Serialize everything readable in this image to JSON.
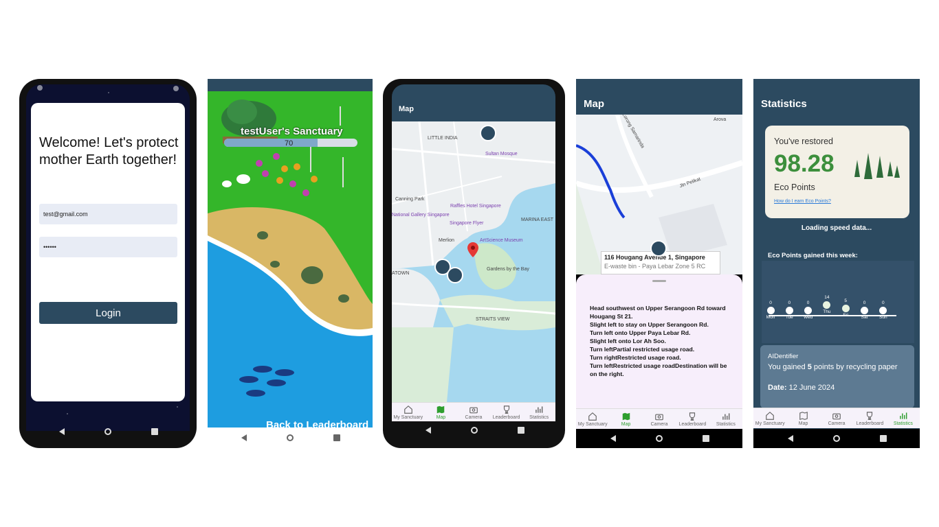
{
  "login": {
    "welcome": "Welcome! Let's protect mother Earth together!",
    "email": "test@gmail.com",
    "password": "••••••",
    "login_button": "Login"
  },
  "sanctuary": {
    "title": "testUser's Sanctuary",
    "xp_value": "70",
    "xp_fraction": 0.7,
    "back_button": "Back to Leaderboard"
  },
  "map": {
    "title": "Map",
    "labels": [
      "LITTLE INDIA",
      "Canning Park",
      "Merlion",
      "MARINA EAST",
      "Gardens by the Bay",
      "STRAITS VIEW",
      "ATOWN"
    ],
    "pois": [
      "Sultan Mosque",
      "Raffles Hotel Singapore",
      "Singapore Flyer",
      "National Gallery Singapore",
      "ArtScience Museum"
    ],
    "tabs": [
      "My Sanctuary",
      "Map",
      "Camera",
      "Leaderboard",
      "Statistics"
    ]
  },
  "map_directions": {
    "title": "Map",
    "street_labels": [
      "Jln Pelikat",
      "Arova",
      "Lorong Samarinda"
    ],
    "address": "116 Hougang Avenue 1, Singapore",
    "bin": "E-waste bin - Paya Lebar Zone 5 RC",
    "directions": [
      "Head southwest on Upper Serangoon Rd toward Hougang St 21.",
      "Slight left to stay on Upper Serangoon Rd.",
      "Turn left onto Upper Paya Lebar Rd.",
      "Slight left onto Lor Ah Soo.",
      "Turn leftPartial restricted usage road.",
      "Turn rightRestricted usage road.",
      "Turn leftRestricted usage roadDestination will be on the right."
    ],
    "tabs": [
      "My Sanctuary",
      "Map",
      "Camera",
      "Leaderboard",
      "Statistics"
    ]
  },
  "statistics": {
    "title": "Statistics",
    "restored_label": "You've restored",
    "eco_points": "98.28",
    "eco_label": "Eco Points",
    "learn_link": "How do I earn Eco Points?",
    "loading": "Loading speed data...",
    "week_label": "Eco Points gained this week:",
    "week": [
      {
        "day": "Mon",
        "points": "0"
      },
      {
        "day": "Tue",
        "points": "0"
      },
      {
        "day": "Wed",
        "points": "0"
      },
      {
        "day": "Thu",
        "points": "14"
      },
      {
        "day": "Fri",
        "points": "5"
      },
      {
        "day": "Sat",
        "points": "0"
      },
      {
        "day": "Sun",
        "points": "0"
      }
    ],
    "activity_source": "AIDentifier",
    "activity_pre": "You gained ",
    "activity_points": "5",
    "activity_post": " points by recycling paper",
    "activity_date_label": "Date:",
    "activity_date": " 12 June 2024",
    "tabs": [
      "My Sanctuary",
      "Map",
      "Camera",
      "Leaderboard",
      "Statistics"
    ]
  },
  "colors": {
    "primary": "#2c4a60",
    "active_tab": "#2e9e2e",
    "eco_green": "#3c8f3c"
  }
}
